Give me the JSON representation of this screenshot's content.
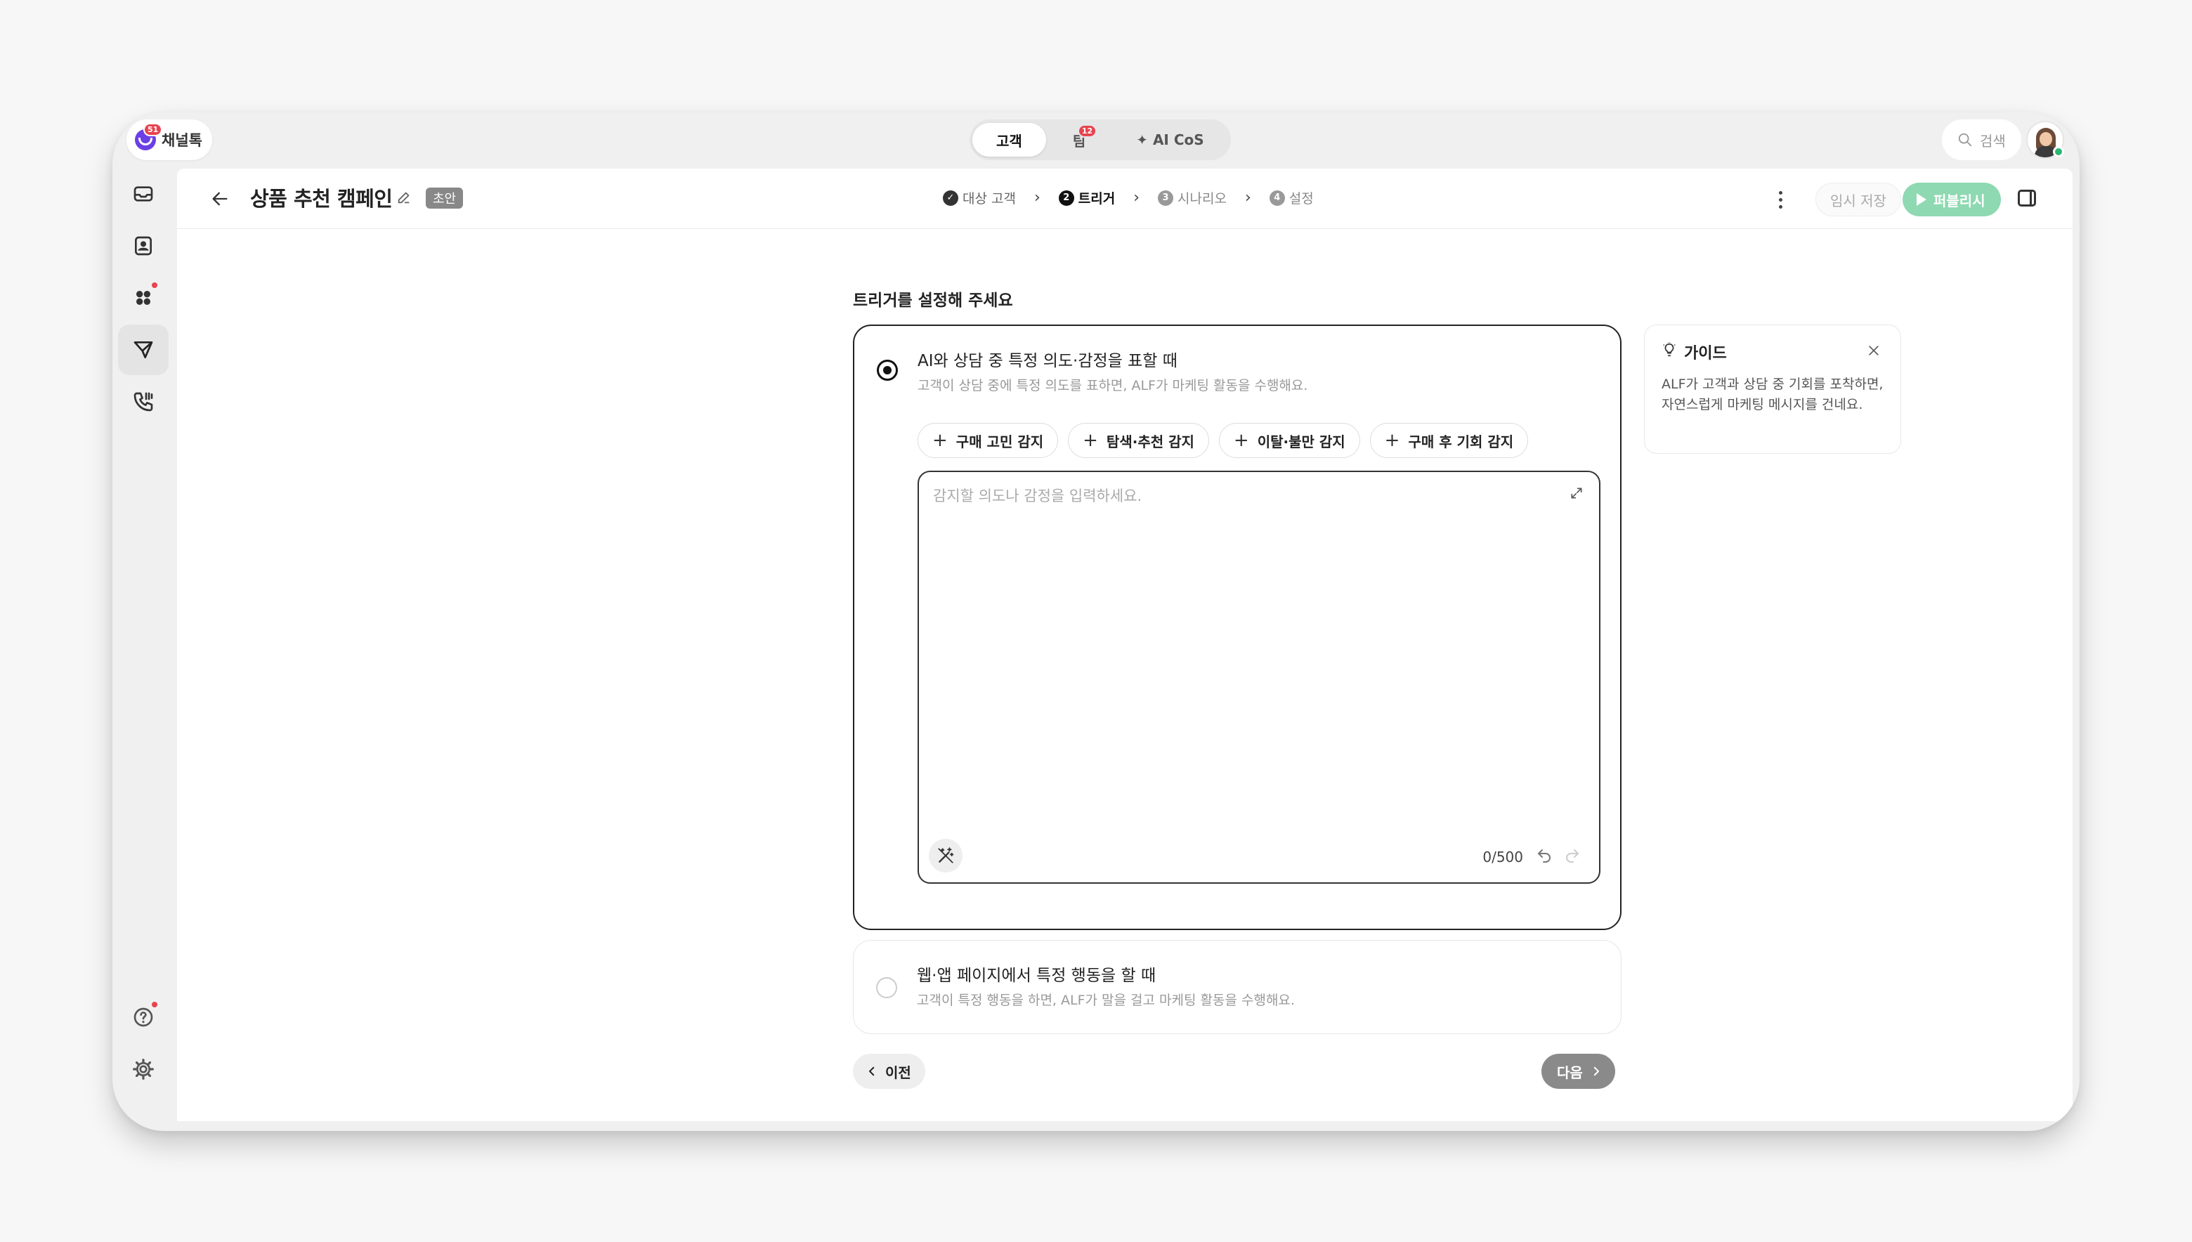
{
  "brand": {
    "name": "채널톡",
    "badge": "51"
  },
  "mode_tabs": [
    {
      "label": "고객",
      "active": true
    },
    {
      "label": "팀",
      "count": "12"
    },
    {
      "label": "✦ AI CoS"
    }
  ],
  "search": {
    "label": "검색"
  },
  "rail": [
    {
      "icon": "inbox-icon"
    },
    {
      "icon": "contacts-icon"
    },
    {
      "icon": "integrations-icon",
      "dot": true
    },
    {
      "icon": "campaign-send-icon",
      "active": true
    },
    {
      "icon": "phone-icon"
    },
    {
      "icon": "help-icon",
      "dot": true
    },
    {
      "icon": "settings-icon"
    }
  ],
  "header": {
    "title": "상품 추천 캠페인",
    "status_badge": "초안",
    "steps": [
      {
        "num": "✓",
        "label": "대상 고객",
        "state": "done"
      },
      {
        "num": "2",
        "label": "트리거",
        "state": "current"
      },
      {
        "num": "3",
        "label": "시나리오",
        "state": "future"
      },
      {
        "num": "4",
        "label": "설정",
        "state": "future"
      }
    ],
    "save_label": "임시 저장",
    "publish_label": "퍼블리시"
  },
  "content": {
    "section_title": "트리거를 설정해 주세요",
    "option1": {
      "title": "AI와 상담 중 특정 의도·감정을 표할 때",
      "desc": "고객이 상담 중에 특정 의도를 표하면, ALF가 마케팅 활동을 수행해요.",
      "chips": [
        "구매 고민 감지",
        "탐색·추천 감지",
        "이탈·불만 감지",
        "구매 후 기회 감지"
      ],
      "placeholder": "감지할 의도나 감정을 입력하세요.",
      "counter": "0/500"
    },
    "option2": {
      "title": "웹·앱 페이지에서 특정 행동을 할 때",
      "desc": "고객이 특정 행동을 하면, ALF가 말을 걸고 마케팅 활동을 수행해요."
    },
    "prev_label": "이전",
    "next_label": "다음"
  },
  "guide": {
    "title": "가이드",
    "body": "ALF가 고객과 상담 중 기회를 포착하면, 자연스럽게 마케팅 메시지를 건네요."
  }
}
